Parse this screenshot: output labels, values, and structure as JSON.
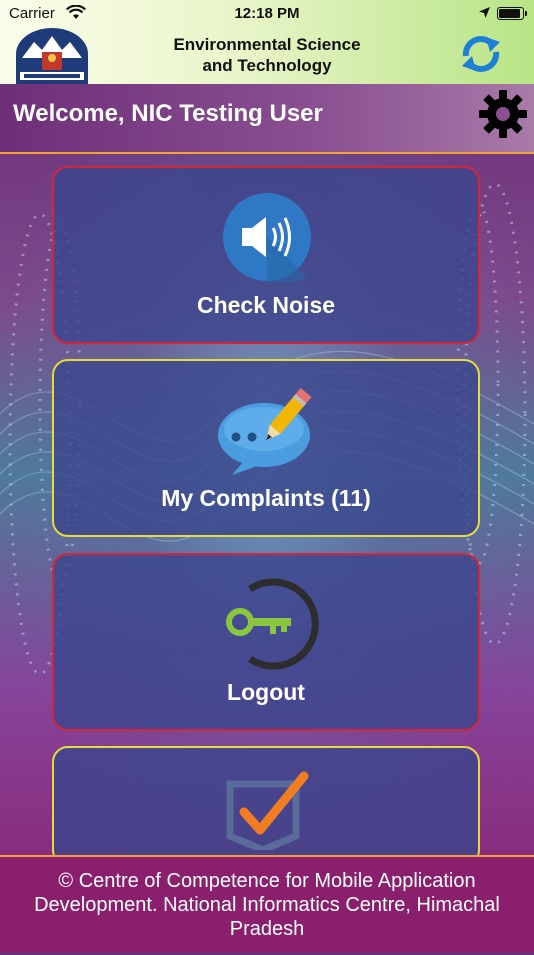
{
  "status_bar": {
    "carrier": "Carrier",
    "time": "12:18 PM"
  },
  "header": {
    "title_line1": "Environmental Science",
    "title_line2": "and Technology",
    "logo_icon": "himachal-pradesh-emblem-icon",
    "refresh_icon": "refresh-icon"
  },
  "welcome": {
    "text": "Welcome, NIC Testing User",
    "settings_icon": "gear-icon"
  },
  "menu": [
    {
      "label": "Check Noise",
      "icon": "speaker-icon",
      "border": "#d2263a"
    },
    {
      "label": "My Complaints (11)",
      "icon": "chat-pencil-icon",
      "border": "#e3dc3a"
    },
    {
      "label": "Logout",
      "icon": "key-icon",
      "border": "#d2263a"
    },
    {
      "label": "",
      "icon": "checkbox-icon",
      "border": "#e3dc3a"
    }
  ],
  "footer": {
    "text": "© Centre of Competence for Mobile Application Development. National Informatics Centre, Himachal Pradesh"
  },
  "colors": {
    "accent_orange": "#f2a03a",
    "card_bg": "#3c468c",
    "footer_bg": "#8a1f6e"
  }
}
